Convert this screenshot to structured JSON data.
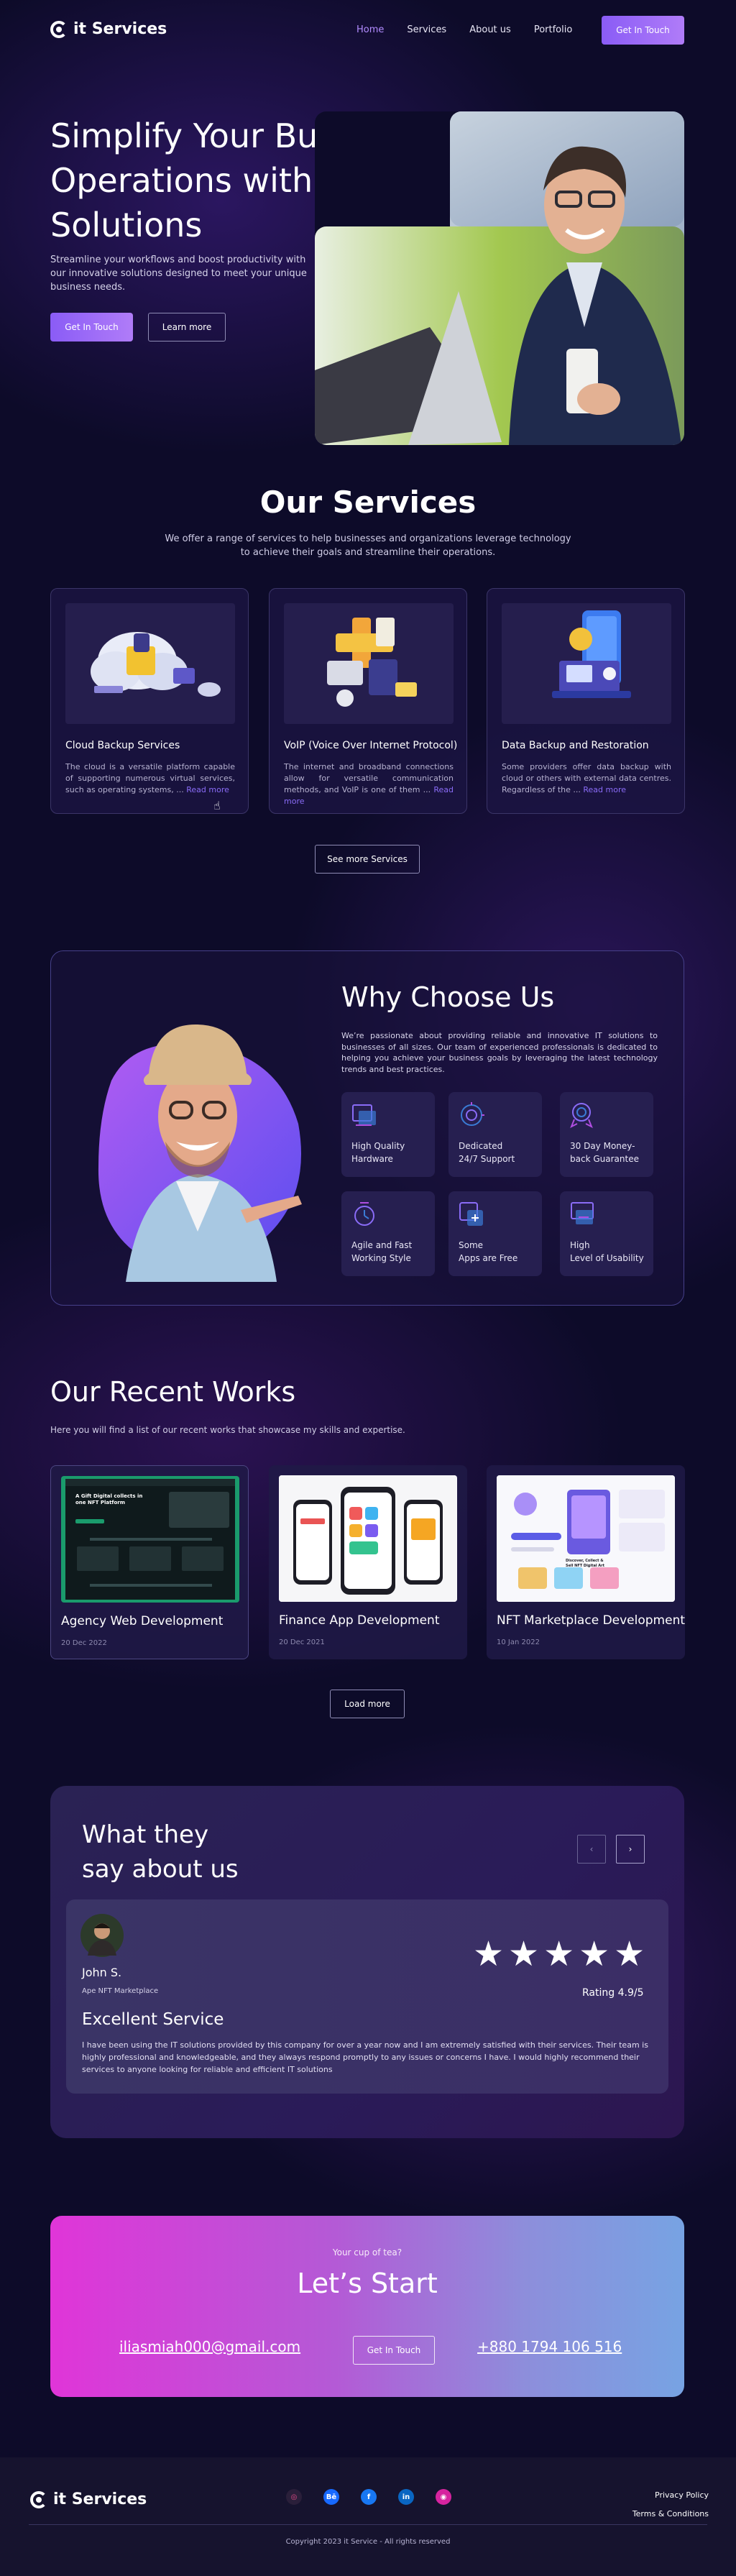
{
  "brand": {
    "name": "it Services"
  },
  "nav": {
    "items": [
      "Home",
      "Services",
      "About us",
      "Portfolio"
    ],
    "cta": "Get In Touch"
  },
  "hero": {
    "title_lines": [
      "Simplify Your Business",
      "Operations with Our",
      "Solutions"
    ],
    "subtitle_lines": [
      "Streamline your workflows and boost productivity with",
      "our innovative solutions designed to meet your unique",
      "business needs."
    ],
    "primary_button": "Get In Touch",
    "secondary_button": "Learn more"
  },
  "services": {
    "title": "Our Services",
    "subtitle_lines": [
      "We offer a range of services to help businesses and organizations leverage technology",
      "to achieve their goals and streamline their operations."
    ],
    "cards": [
      {
        "title": "Cloud Backup Services",
        "text": "The cloud is a versatile platform capable of supporting numerous virtual services, such as operating systems, ... ",
        "read_more": "Read more",
        "icon": "cloud-backup-illustration"
      },
      {
        "title": "VoIP (Voice Over Internet Protocol)",
        "text": "The internet and broadband connections allow for versatile communication methods, and VoIP is one of them ... ",
        "read_more": "Read more",
        "icon": "voip-illustration"
      },
      {
        "title": "Data Backup and Restoration",
        "text": "Some providers offer data backup with cloud or others with external data centres. Regardless of the ... ",
        "read_more": "Read more",
        "icon": "data-backup-illustration"
      }
    ],
    "more_button": "See more Services"
  },
  "why": {
    "title": "Why Choose Us",
    "text": "We’re passionate about providing reliable and innovative IT solutions to businesses of all sizes. Our team of experienced professionals is dedicated to helping you achieve your business goals by leveraging the latest technology trends and best practices.",
    "features": [
      {
        "line1": "High Quality",
        "line2": "Hardware",
        "icon": "hardware-icon"
      },
      {
        "line1": "Dedicated",
        "line2": "24/7 Support",
        "icon": "support-icon"
      },
      {
        "line1": "30 Day Money-",
        "line2": "back Guarantee",
        "icon": "guarantee-icon"
      },
      {
        "line1": "Agile and Fast",
        "line2": "Working Style",
        "icon": "agile-icon"
      },
      {
        "line1": "Some",
        "line2": "Apps are Free",
        "icon": "free-apps-icon"
      },
      {
        "line1": "High",
        "line2": "Level of Usability",
        "icon": "usability-icon"
      }
    ]
  },
  "works": {
    "title": "Our Recent Works",
    "subtitle": "Here you will find a list of our recent works that showcase my skills and expertise.",
    "items": [
      {
        "title": "Agency Web Development",
        "date": "20 Dec 2022"
      },
      {
        "title": "Finance App Development",
        "date": "20 Dec 2021"
      },
      {
        "title": "NFT Marketplace Development",
        "date": "10 Jan 2022"
      }
    ],
    "load_button": "Load more",
    "mock_text": {
      "headline": "A Gift Digital collects in one NFT Platform",
      "nft_title": "Discover, Collect & Sell NFT Digital Art"
    }
  },
  "testimonials": {
    "title_lines": [
      "What they",
      "say about us"
    ],
    "prev": "‹",
    "next": "›",
    "name": "John S.",
    "role": "Ape NFT Marketplace",
    "stars": "★★★★★",
    "rating": "Rating 4.9/5",
    "heading": "Excellent Service",
    "quote": "I have been using the IT solutions provided by this company for over a year now and I am extremely satisfied with their services. Their team is highly professional and knowledgeable, and they always respond promptly to any issues or concerns I have. I would highly recommend their services to anyone looking for reliable and efficient IT solutions"
  },
  "cta": {
    "kicker": "Your cup of tea?",
    "title": "Let’s Start",
    "email": "iliasmiah000@gmail.com",
    "button": "Get In Touch",
    "phone": "+880 1794 106 516"
  },
  "footer": {
    "socials": [
      {
        "name": "dribbble-icon",
        "glyph": "◎",
        "color": "#ea4c89",
        "bg": "#2a1f3a"
      },
      {
        "name": "behance-icon",
        "glyph": "Bē",
        "color": "#ffffff",
        "bg": "#1769ff"
      },
      {
        "name": "facebook-icon",
        "glyph": "f",
        "color": "#ffffff",
        "bg": "#1877f2"
      },
      {
        "name": "linkedin-icon",
        "glyph": "in",
        "color": "#ffffff",
        "bg": "#0a66c2"
      },
      {
        "name": "instagram-icon",
        "glyph": "◉",
        "color": "#ffffff",
        "bg": "#d6249f"
      }
    ],
    "links": [
      "Privacy Policy",
      "Terms & Conditions"
    ],
    "copyright": "Copyright 2023 it Service - All rights reserved"
  }
}
